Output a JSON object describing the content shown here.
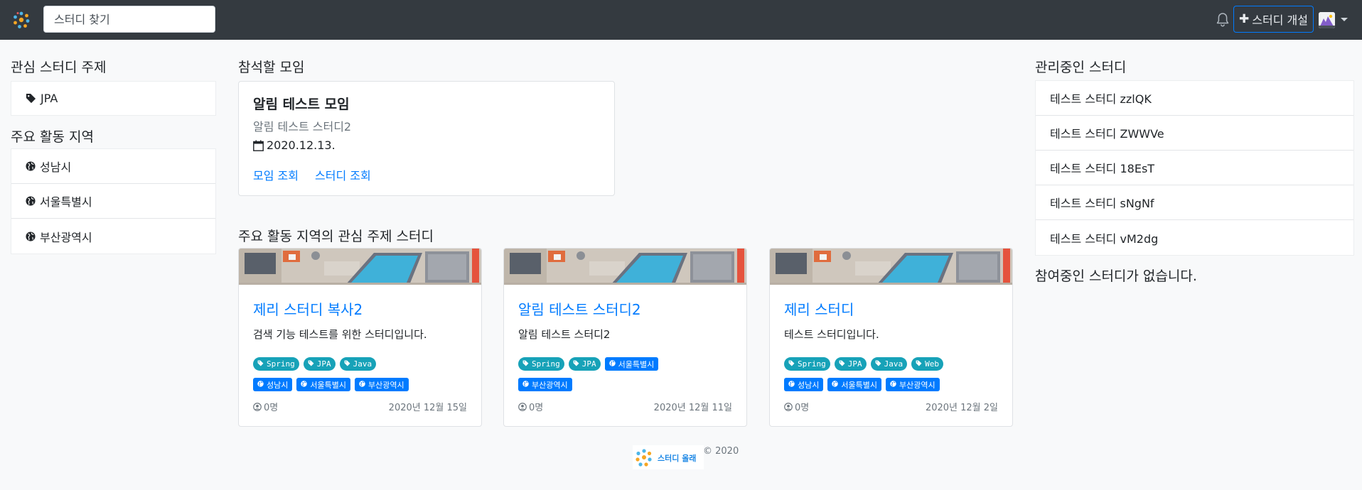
{
  "navbar": {
    "logo_icon": "study-olle-logo-icon",
    "search_placeholder": "스터디 찾기",
    "bell_icon": "bell-icon",
    "open_study_label": "스터디 개설",
    "avatar_icon": "avatar-icon"
  },
  "left": {
    "interests_heading": "관심 스터디 주제",
    "interests": [
      {
        "label": "JPA",
        "icon": "tag-icon"
      }
    ],
    "zones_heading": "주요 활동 지역",
    "zones": [
      {
        "label": "성남시",
        "icon": "globe-icon"
      },
      {
        "label": "서울특별시",
        "icon": "globe-icon"
      },
      {
        "label": "부산광역시",
        "icon": "globe-icon"
      }
    ]
  },
  "events": {
    "heading": "참석할 모임",
    "items": [
      {
        "title": "알림 테스트 모임",
        "study": "알림 테스트 스터디2",
        "date": "2020.12.13.",
        "view_event_label": "모임 조회",
        "view_study_label": "스터디 조회"
      }
    ]
  },
  "studies": {
    "heading": "주요 활동 지역의 관심 주제 스터디",
    "cards": [
      {
        "title": "제리 스터디 복사2",
        "description": "검색 기능 테스트를 위한 스터디입니다.",
        "tags": [
          "Spring",
          "JPA",
          "Java"
        ],
        "zones": [
          "성남시",
          "서울특별시",
          "부산광역시"
        ],
        "members": "0명",
        "date": "2020년 12월 15일"
      },
      {
        "title": "알림 테스트 스터디2",
        "description": "알림 테스트 스터디2",
        "tags": [
          "Spring",
          "JPA"
        ],
        "zones": [
          "서울특별시",
          "부산광역시"
        ],
        "members": "0명",
        "date": "2020년 12월 11일"
      },
      {
        "title": "제리 스터디",
        "description": "테스트 스터디입니다.",
        "tags": [
          "Spring",
          "JPA",
          "Java",
          "Web"
        ],
        "zones": [
          "성남시",
          "서울특별시",
          "부산광역시"
        ],
        "members": "0명",
        "date": "2020년 12월 2일"
      }
    ]
  },
  "managing": {
    "heading": "관리중인 스터디",
    "items": [
      "테스트 스터디 zzlQK",
      "테스트 스터디 ZWWVe",
      "테스트 스터디 18EsT",
      "테스트 스터디 sNgNf",
      "테스트 스터디 vM2dg"
    ],
    "none_joined": "참여중인 스터디가 없습니다."
  },
  "footer": {
    "logo_text": "스터디 올래",
    "copyright": "© 2020"
  },
  "colors": {
    "navbar": "#343a40",
    "link": "#007bff",
    "topic_badge": "#17a2b8",
    "zone_badge": "#007bff"
  }
}
